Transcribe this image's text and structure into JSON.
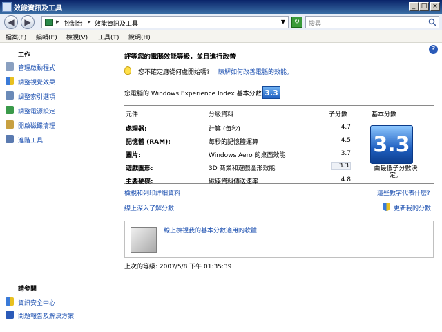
{
  "window": {
    "title": "效能資訊及工具",
    "minimize": "_",
    "maximize": "□",
    "close": "×"
  },
  "address": {
    "root": "控制台",
    "current": "效能資訊及工具",
    "separator": "▸",
    "back": "◀",
    "forward": "▶",
    "search_placeholder": "搜尋"
  },
  "menu": [
    "檔案(F)",
    "編輯(E)",
    "檢視(V)",
    "工具(T)",
    "說明(H)"
  ],
  "tasks": {
    "heading": "工作",
    "items": [
      {
        "label": "管理啟動程式",
        "icon": "startup-programs-icon",
        "color": "#8aa0c0"
      },
      {
        "label": "調整視覺效果",
        "icon": "shield-icon",
        "color": "#3a7ad8"
      },
      {
        "label": "調整索引選項",
        "icon": "indexing-icon",
        "color": "#6a8ab8"
      },
      {
        "label": "調整電源設定",
        "icon": "power-options-icon",
        "color": "#3a9a4a"
      },
      {
        "label": "開啟磁碟清理",
        "icon": "disk-cleanup-icon",
        "color": "#c8a040"
      },
      {
        "label": "進階工具",
        "icon": "advanced-tools-icon",
        "color": "#5a7ab0"
      }
    ]
  },
  "see_also": {
    "heading": "請參閱",
    "items": [
      {
        "label": "資訊安全中心",
        "icon": "security-center-icon",
        "color": "#e8c020"
      },
      {
        "label": "問題報告及解決方案",
        "icon": "problem-reports-icon",
        "color": "#2a5ab8"
      }
    ]
  },
  "main": {
    "help": "?",
    "heading": "評等您的電腦效能等級，並且進行改善",
    "tip": "您不確定應從何處開始嗎?",
    "tip_link": "瞭解如何改善電腦的效能。",
    "score_text": "您電腦的 Windows Experience Index 基本分數為",
    "base_score": "3.3",
    "columns": {
      "component": "元件",
      "rating": "分級資料",
      "subscore": "子分數",
      "base": "基本分數"
    },
    "rows": [
      {
        "component": "處理器:",
        "rating": "計算 (每秒)",
        "subscore": "4.7"
      },
      {
        "component": "記憶體 (RAM):",
        "rating": "每秒的記憶體運算",
        "subscore": "4.5"
      },
      {
        "component": "圖片:",
        "rating": "Windows Aero 的桌面效能",
        "subscore": "3.7"
      },
      {
        "component": "遊戲圖形:",
        "rating": "3D 商業和遊戲圖形效能",
        "subscore": "3.3"
      },
      {
        "component": "主要硬碟:",
        "rating": "磁碟資料傳送速率",
        "subscore": "4.8"
      }
    ],
    "base_caption": "由最低子分數決定。",
    "link_view_details": "檢視和列印詳細資料",
    "link_what_mean": "這些數字代表什麼?",
    "link_learn_online": "線上深入了解分數",
    "link_update": "更新我的分數",
    "software_link": "線上檢視我的基本分數適用的軟體",
    "last_rating": "上次的等級: 2007/5/8 下午 01:35:39"
  }
}
